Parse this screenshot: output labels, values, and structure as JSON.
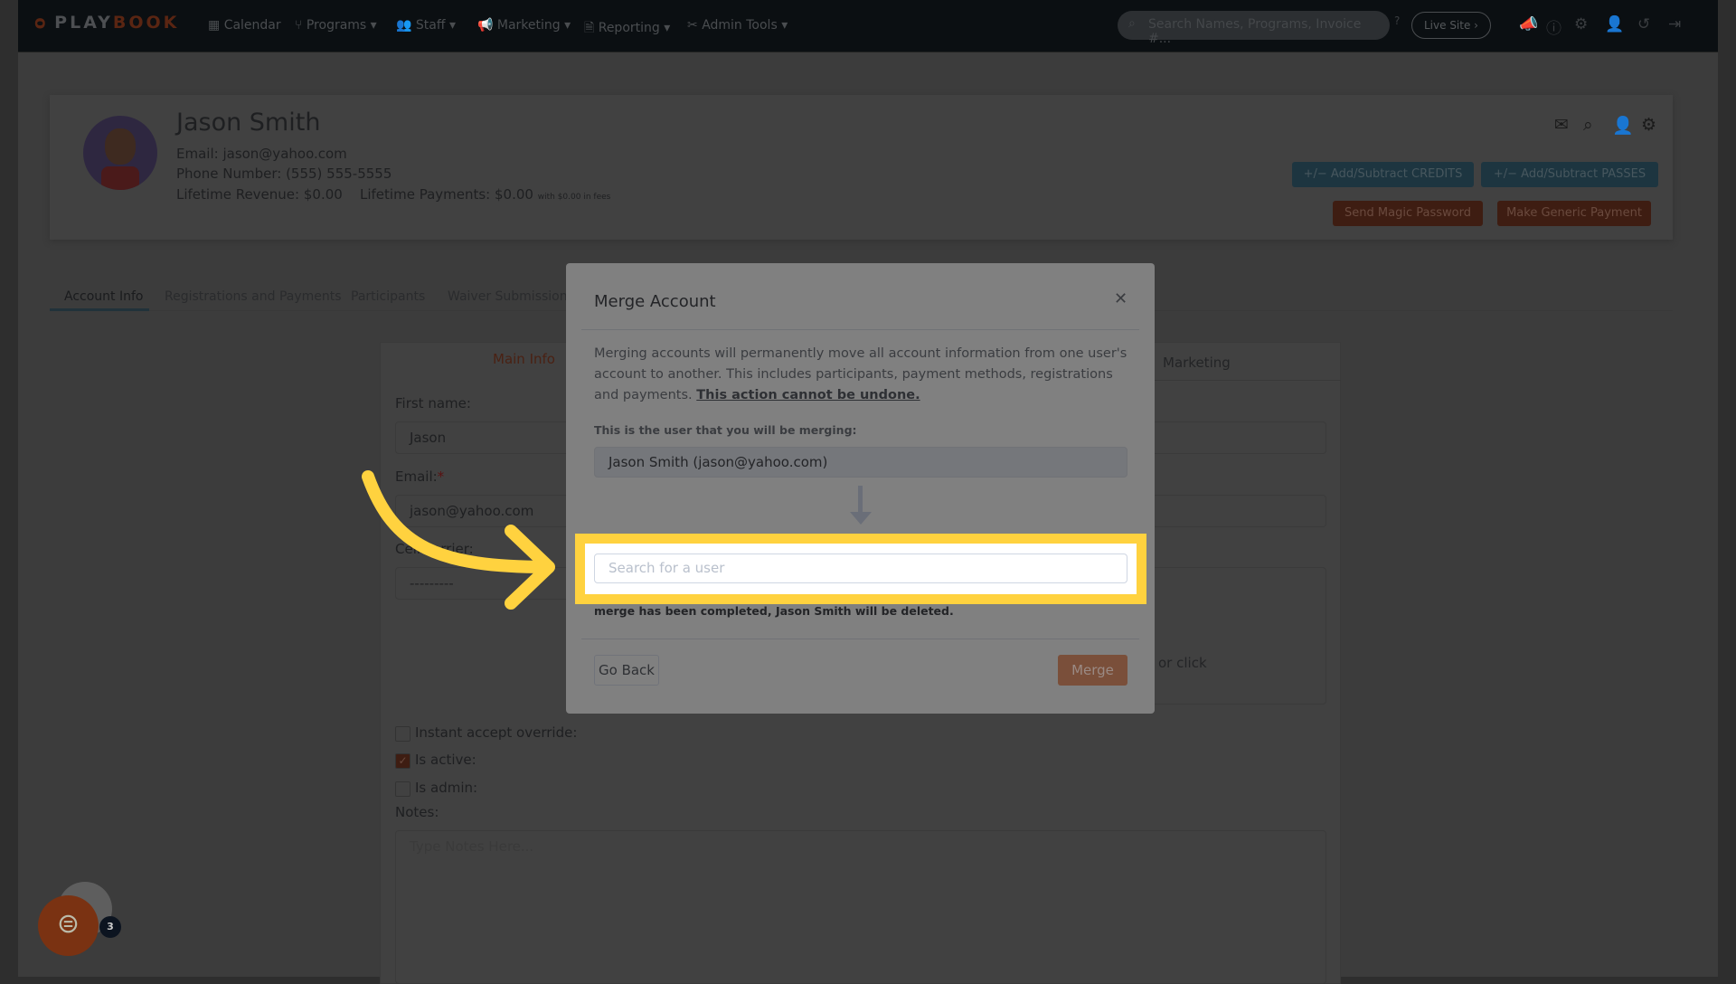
{
  "nav": {
    "brand_prefix": "PLAY",
    "brand_suffix": "BOOK",
    "items": [
      {
        "label": "Calendar",
        "icon": "calendar-icon"
      },
      {
        "label": "Programs",
        "icon": "branch-icon"
      },
      {
        "label": "Staff",
        "icon": "users-icon"
      },
      {
        "label": "Marketing",
        "icon": "megaphone-icon"
      },
      {
        "label": "Reporting",
        "icon": "file-icon"
      },
      {
        "label": "Admin Tools",
        "icon": "tools-icon"
      }
    ],
    "search_placeholder": "Search Names, Programs, Invoice #...",
    "live_site": "Live Site"
  },
  "profile": {
    "name": "Jason Smith",
    "email_label": "Email:",
    "email": "jason@yahoo.com",
    "phone_label": "Phone Number:",
    "phone": "(555) 555-5555",
    "revenue_label": "Lifetime Revenue:",
    "revenue": "$0.00",
    "payments_label": "Lifetime Payments:",
    "payments": "$0.00",
    "fees_note": "with $0.00 in fees",
    "credits_btn": "+/−  Add/Subtract CREDITS",
    "passes_btn": "+/−  Add/Subtract PASSES",
    "magic_btn": "Send Magic Password",
    "generic_btn": "Make Generic Payment"
  },
  "tabs": [
    "Account Info",
    "Registrations and Payments",
    "Participants",
    "Waiver Submissions"
  ],
  "form": {
    "main_tab": "Main Info",
    "marketing_tab": "Marketing",
    "first_name_label": "First name:",
    "first_name": "Jason",
    "email_label": "Email:",
    "email": "jason@yahoo.com",
    "carrier_label": "Cell carrier:",
    "carrier": "---------",
    "or_click": "or click",
    "instant_label": "Instant accept override:",
    "active_label": "Is active:",
    "admin_label": "Is admin:",
    "notes_label": "Notes:",
    "notes_placeholder": "Type Notes Here...",
    "is_active": true,
    "is_admin": false,
    "instant_accept": false
  },
  "modal": {
    "title": "Merge Account",
    "body": "Merging accounts will permanently move all account information from one user's account to another. This includes participants, payment methods, registrations and payments. ",
    "warning": "This action cannot be undone.",
    "merging_label": "This is the user that you will be merging:",
    "merging_user": "Jason Smith (jason@yahoo.com)",
    "search_placeholder": "Search for a user",
    "deleted_note": "merge has been completed, Jason Smith will be deleted.",
    "go_back": "Go Back",
    "merge": "Merge"
  },
  "chat": {
    "badge": "3"
  },
  "colors": {
    "highlight": "#ffd23f",
    "accent": "#c2571f",
    "teal": "#1f7a99"
  }
}
